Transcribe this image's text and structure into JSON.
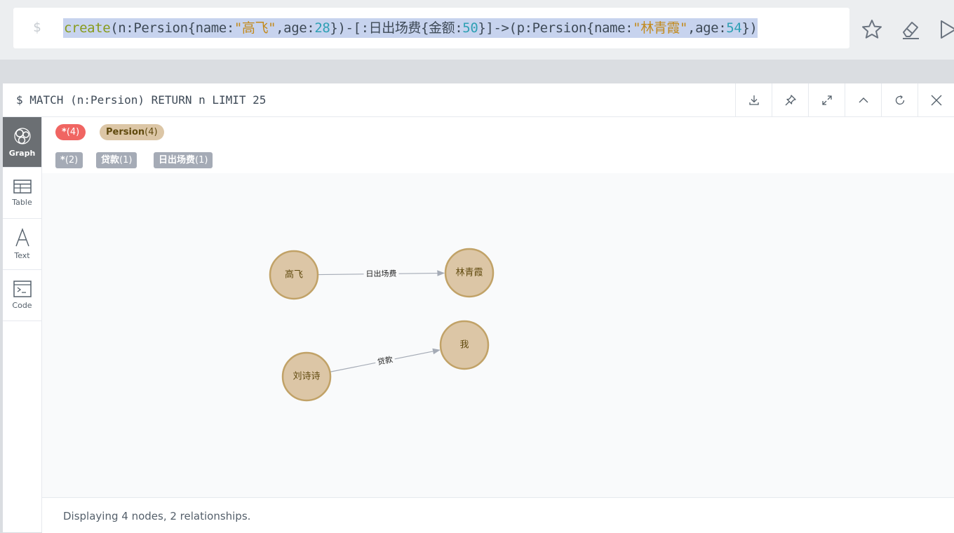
{
  "editor": {
    "prompt": "$",
    "code_tokens": [
      {
        "t": "create",
        "c": "kw"
      },
      {
        "t": "(n:Persion{name:",
        "c": ""
      },
      {
        "t": "\"高飞\"",
        "c": "str"
      },
      {
        "t": ",age:",
        "c": ""
      },
      {
        "t": "28",
        "c": "num"
      },
      {
        "t": "})-[:日出场费{金额:",
        "c": ""
      },
      {
        "t": "50",
        "c": "num"
      },
      {
        "t": "}]->(p:Persion{name:",
        "c": ""
      },
      {
        "t": "\"林青霞\"",
        "c": "str"
      },
      {
        "t": ",age:",
        "c": ""
      },
      {
        "t": "54",
        "c": "num"
      },
      {
        "t": "})",
        "c": ""
      }
    ],
    "buttons": [
      {
        "name": "favorite-button",
        "icon": "star-icon"
      },
      {
        "name": "clear-button",
        "icon": "eraser-icon"
      },
      {
        "name": "run-button",
        "icon": "play-icon"
      }
    ]
  },
  "frame": {
    "query": "$ MATCH (n:Persion) RETURN n LIMIT 25",
    "actions": [
      {
        "name": "download-button",
        "icon": "download-icon"
      },
      {
        "name": "pin-button",
        "icon": "pin-icon"
      },
      {
        "name": "fullscreen-button",
        "icon": "expand-icon"
      },
      {
        "name": "collapse-button",
        "icon": "chevron-up-icon"
      },
      {
        "name": "rerun-button",
        "icon": "refresh-icon"
      },
      {
        "name": "close-button",
        "icon": "close-icon"
      }
    ]
  },
  "sidebar": {
    "items": [
      {
        "label": "Graph",
        "icon": "graph-icon",
        "active": true
      },
      {
        "label": "Table",
        "icon": "table-icon",
        "active": false
      },
      {
        "label": "Text",
        "icon": "text-icon",
        "active": false
      },
      {
        "label": "Code",
        "icon": "code-icon",
        "active": false
      }
    ]
  },
  "legend": {
    "node_labels": [
      {
        "label": "*",
        "count": "(4)",
        "bg": "#f06562",
        "fg": "#ffffff"
      },
      {
        "label": "Persion",
        "count": "(4)",
        "bg": "#dcc6a6",
        "fg": "#604a0e"
      }
    ],
    "relationship_types": [
      {
        "label": "*",
        "count": "(2)",
        "bg": "#a5abb6",
        "fg": "#ffffff"
      },
      {
        "label": "贷款",
        "count": "(1)",
        "bg": "#a5abb6",
        "fg": "#ffffff"
      },
      {
        "label": "日出场费",
        "count": "(1)",
        "bg": "#a5abb6",
        "fg": "#ffffff"
      }
    ]
  },
  "graph": {
    "node_fill": "#dcc6a6",
    "node_stroke": "#c1a267",
    "node_text": "#604a0e",
    "edge_color": "#a5abb6",
    "nodes": [
      {
        "id": "gaofei",
        "name": "高飞"
      },
      {
        "id": "linqingxia",
        "name": "林青霞"
      },
      {
        "id": "liushishi",
        "name": "刘诗诗"
      },
      {
        "id": "wo",
        "name": "我"
      }
    ],
    "relationships": [
      {
        "from": "gaofei",
        "to": "linqingxia",
        "type": "日出场费"
      },
      {
        "from": "liushishi",
        "to": "wo",
        "type": "贷款"
      }
    ]
  },
  "status": "Displaying 4 nodes, 2 relationships."
}
